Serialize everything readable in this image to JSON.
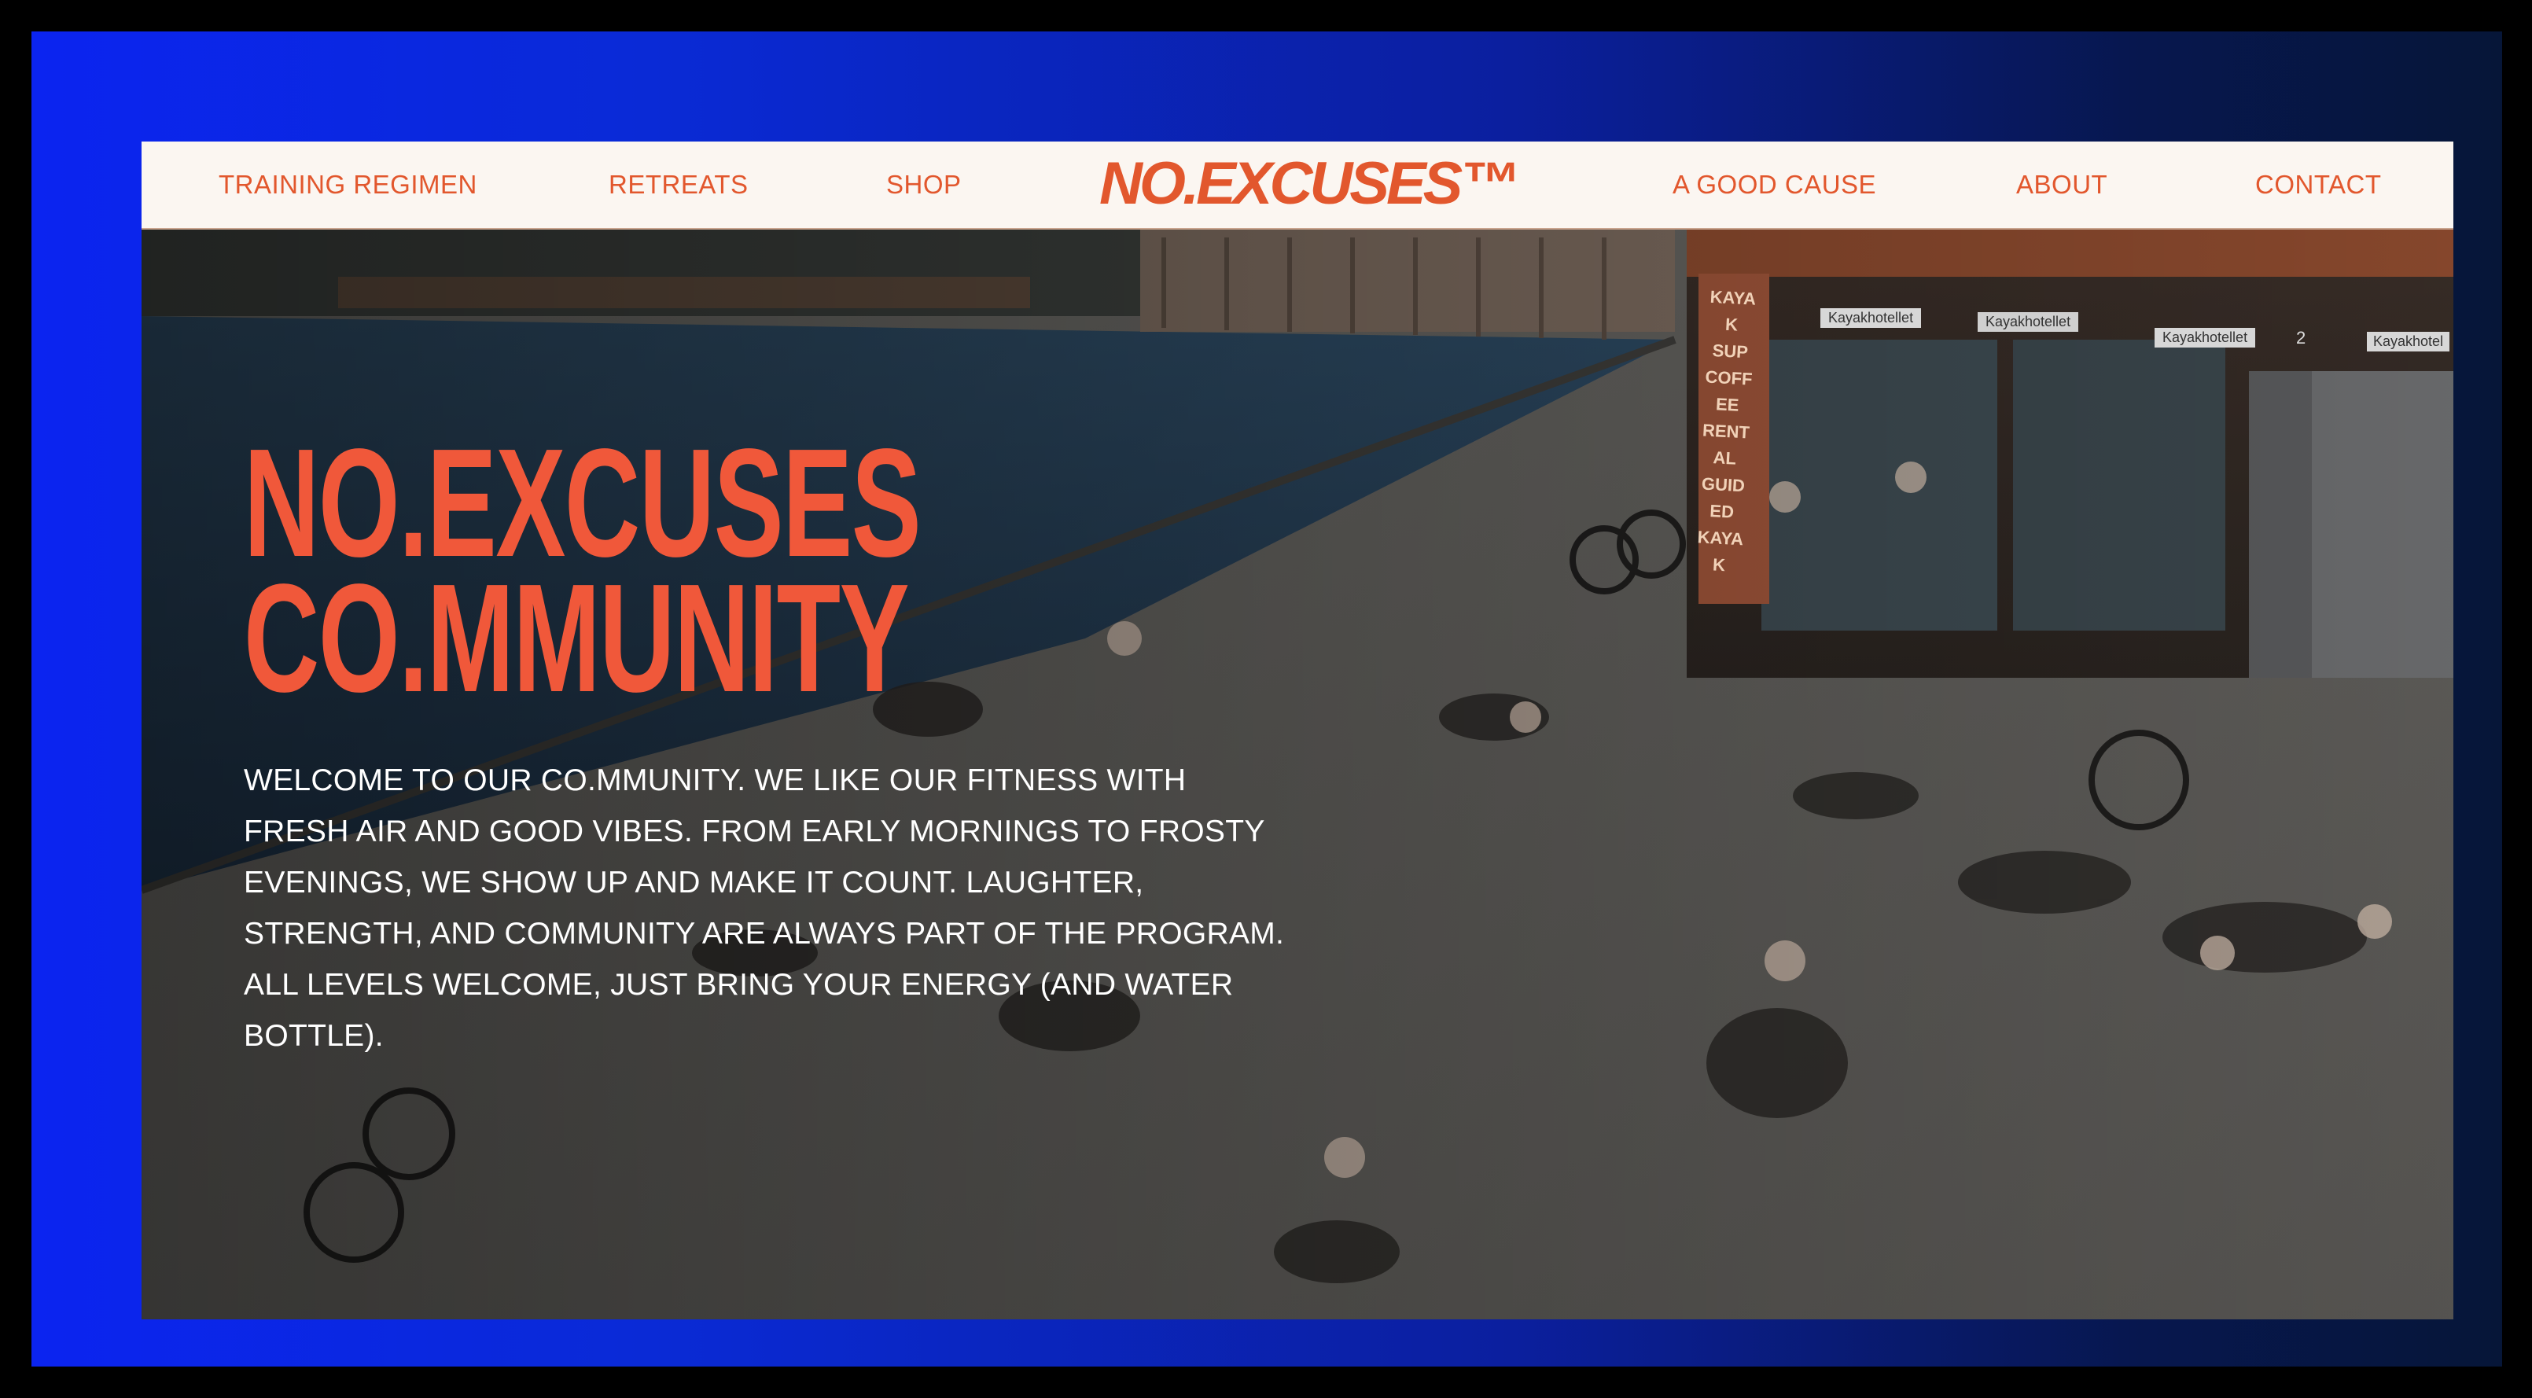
{
  "colors": {
    "accent": "#e2572d",
    "nav_background": "#fbf6f1",
    "frame_gradient_start": "#0b24f0",
    "frame_gradient_end": "#061638",
    "hero_text": "#ffffff"
  },
  "nav": {
    "left_items": [
      {
        "label": "TRAINING REGIMEN"
      },
      {
        "label": "RETREATS"
      },
      {
        "label": "SHOP"
      }
    ],
    "logo": "NO.EXCUSES™",
    "right_items": [
      {
        "label": "A GOOD CAUSE"
      },
      {
        "label": "ABOUT"
      },
      {
        "label": "CONTACT"
      }
    ]
  },
  "hero": {
    "title_line1": "NO.EXCUSES",
    "title_line2": "CO.MMUNITY",
    "description": "WELCOME TO OUR CO.MMUNITY. WE LIKE OUR FITNESS WITH FRESH AIR AND GOOD VIBES. FROM EARLY MORNINGS TO FROSTY EVENINGS, WE SHOW UP AND MAKE IT COUNT. LAUGHTER, STRENGTH, AND COMMUNITY ARE ALWAYS PART OF THE PROGRAM. ALL LEVELS WELCOME, JUST BRING YOUR ENERGY (AND WATER BOTTLE).",
    "photo_signs": {
      "banner": "KAYAK SUP COFFEE RENTAL GUIDED KAYAK",
      "sign1": "Kayakhotellet",
      "sign2": "Kayakhotellet",
      "sign3": "Kayakhotellet",
      "sign4": "2",
      "sign5": "Kayakhotel"
    }
  }
}
